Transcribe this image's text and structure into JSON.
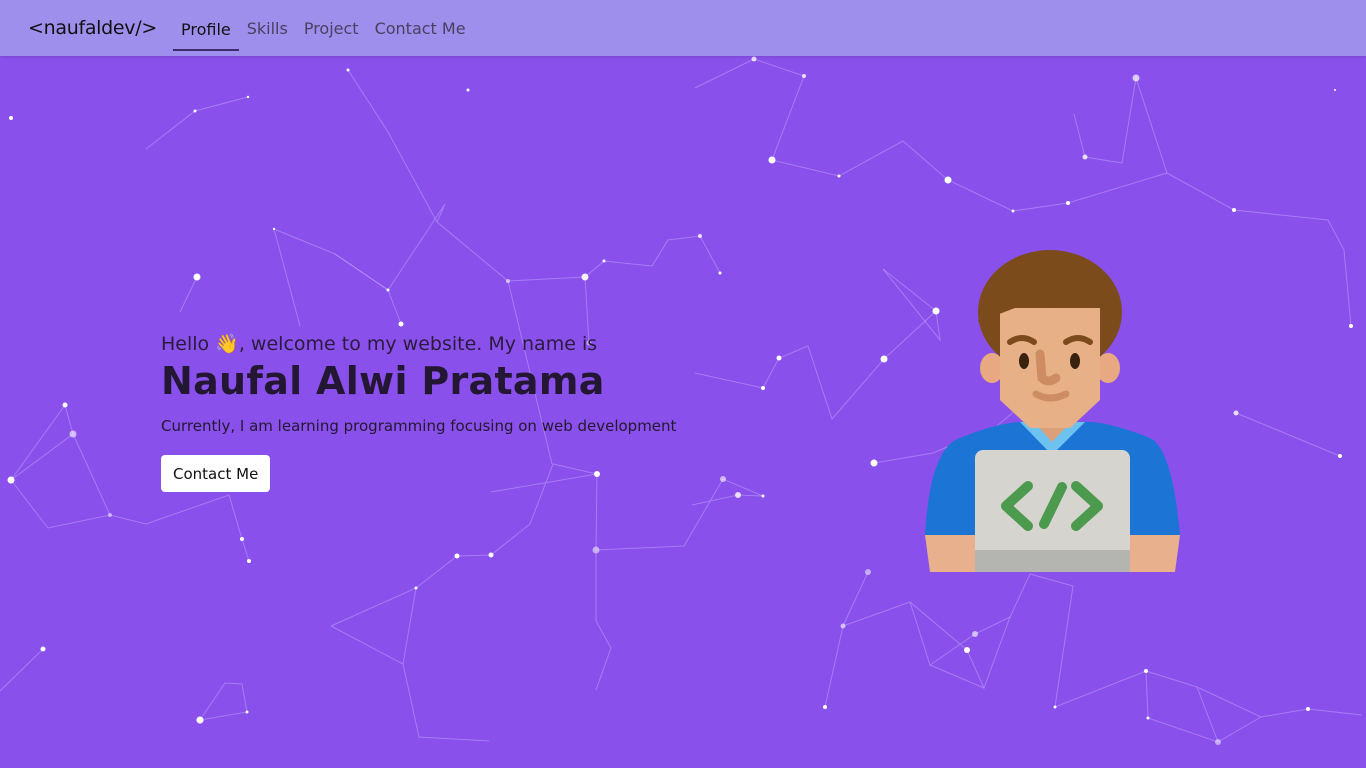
{
  "navbar": {
    "brand": "<naufaldev/>",
    "links": [
      {
        "label": "Profile",
        "active": true
      },
      {
        "label": "Skills",
        "active": false
      },
      {
        "label": "Project",
        "active": false
      },
      {
        "label": "Contact Me",
        "active": false
      }
    ]
  },
  "hero": {
    "greeting": "Hello 👋, welcome to my website. My name is",
    "name": "Naufal Alwi Pratama",
    "tagline": "Currently, I am learning programming focusing on web development",
    "cta_label": "Contact Me"
  },
  "illustration": {
    "icon": "developer-laptop-icon",
    "laptop_symbol": "</>"
  },
  "colors": {
    "background": "#8a50ec",
    "navbar": "#9e8fec",
    "accent": "#ffffff"
  }
}
